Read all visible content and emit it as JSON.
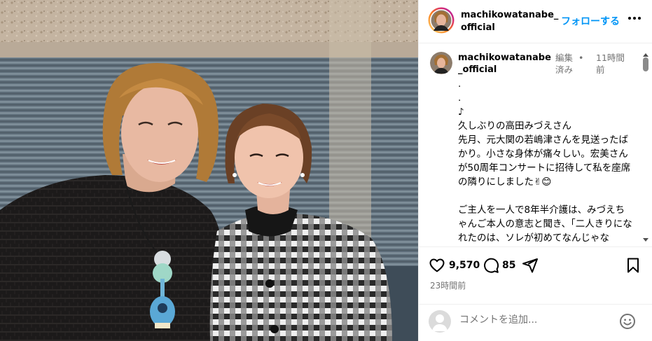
{
  "post": {
    "username": "machikowatanabe_official",
    "follow_label": "フォローする",
    "edited_label": "編集済み",
    "dot": "•",
    "time_ago": "11時間前",
    "caption": ".\n.\n♪\n久しぶりの高田みづえさん\n先月、元大関の若嶋津さんを見送ったばかり。小さな身体が痛々しい。宏美さんが50周年コンサートに招待して私を座席の隣りにしました✌😊\n\nご主人を一人で8年半介護は、みづえちゃんご本人の意志と聞き、「二人きりになれたのは、ソレが初めてなんじゃない？！」『そう』「(大変だったろうけど)いい時間だったね？」『うん』",
    "likes": "9,570",
    "comments": "85",
    "age": "23時間前"
  },
  "comment_box": {
    "placeholder": "コメントを追加..."
  },
  "icons": {
    "more": "more-horizontal-icon",
    "like": "heart-icon",
    "comment": "comment-bubble-icon",
    "share": "share-paper-plane-icon",
    "save": "bookmark-icon",
    "emoji": "emoji-smiley-icon"
  },
  "colors": {
    "accent": "#0095f6",
    "muted": "#737373",
    "divider": "#efefef"
  }
}
